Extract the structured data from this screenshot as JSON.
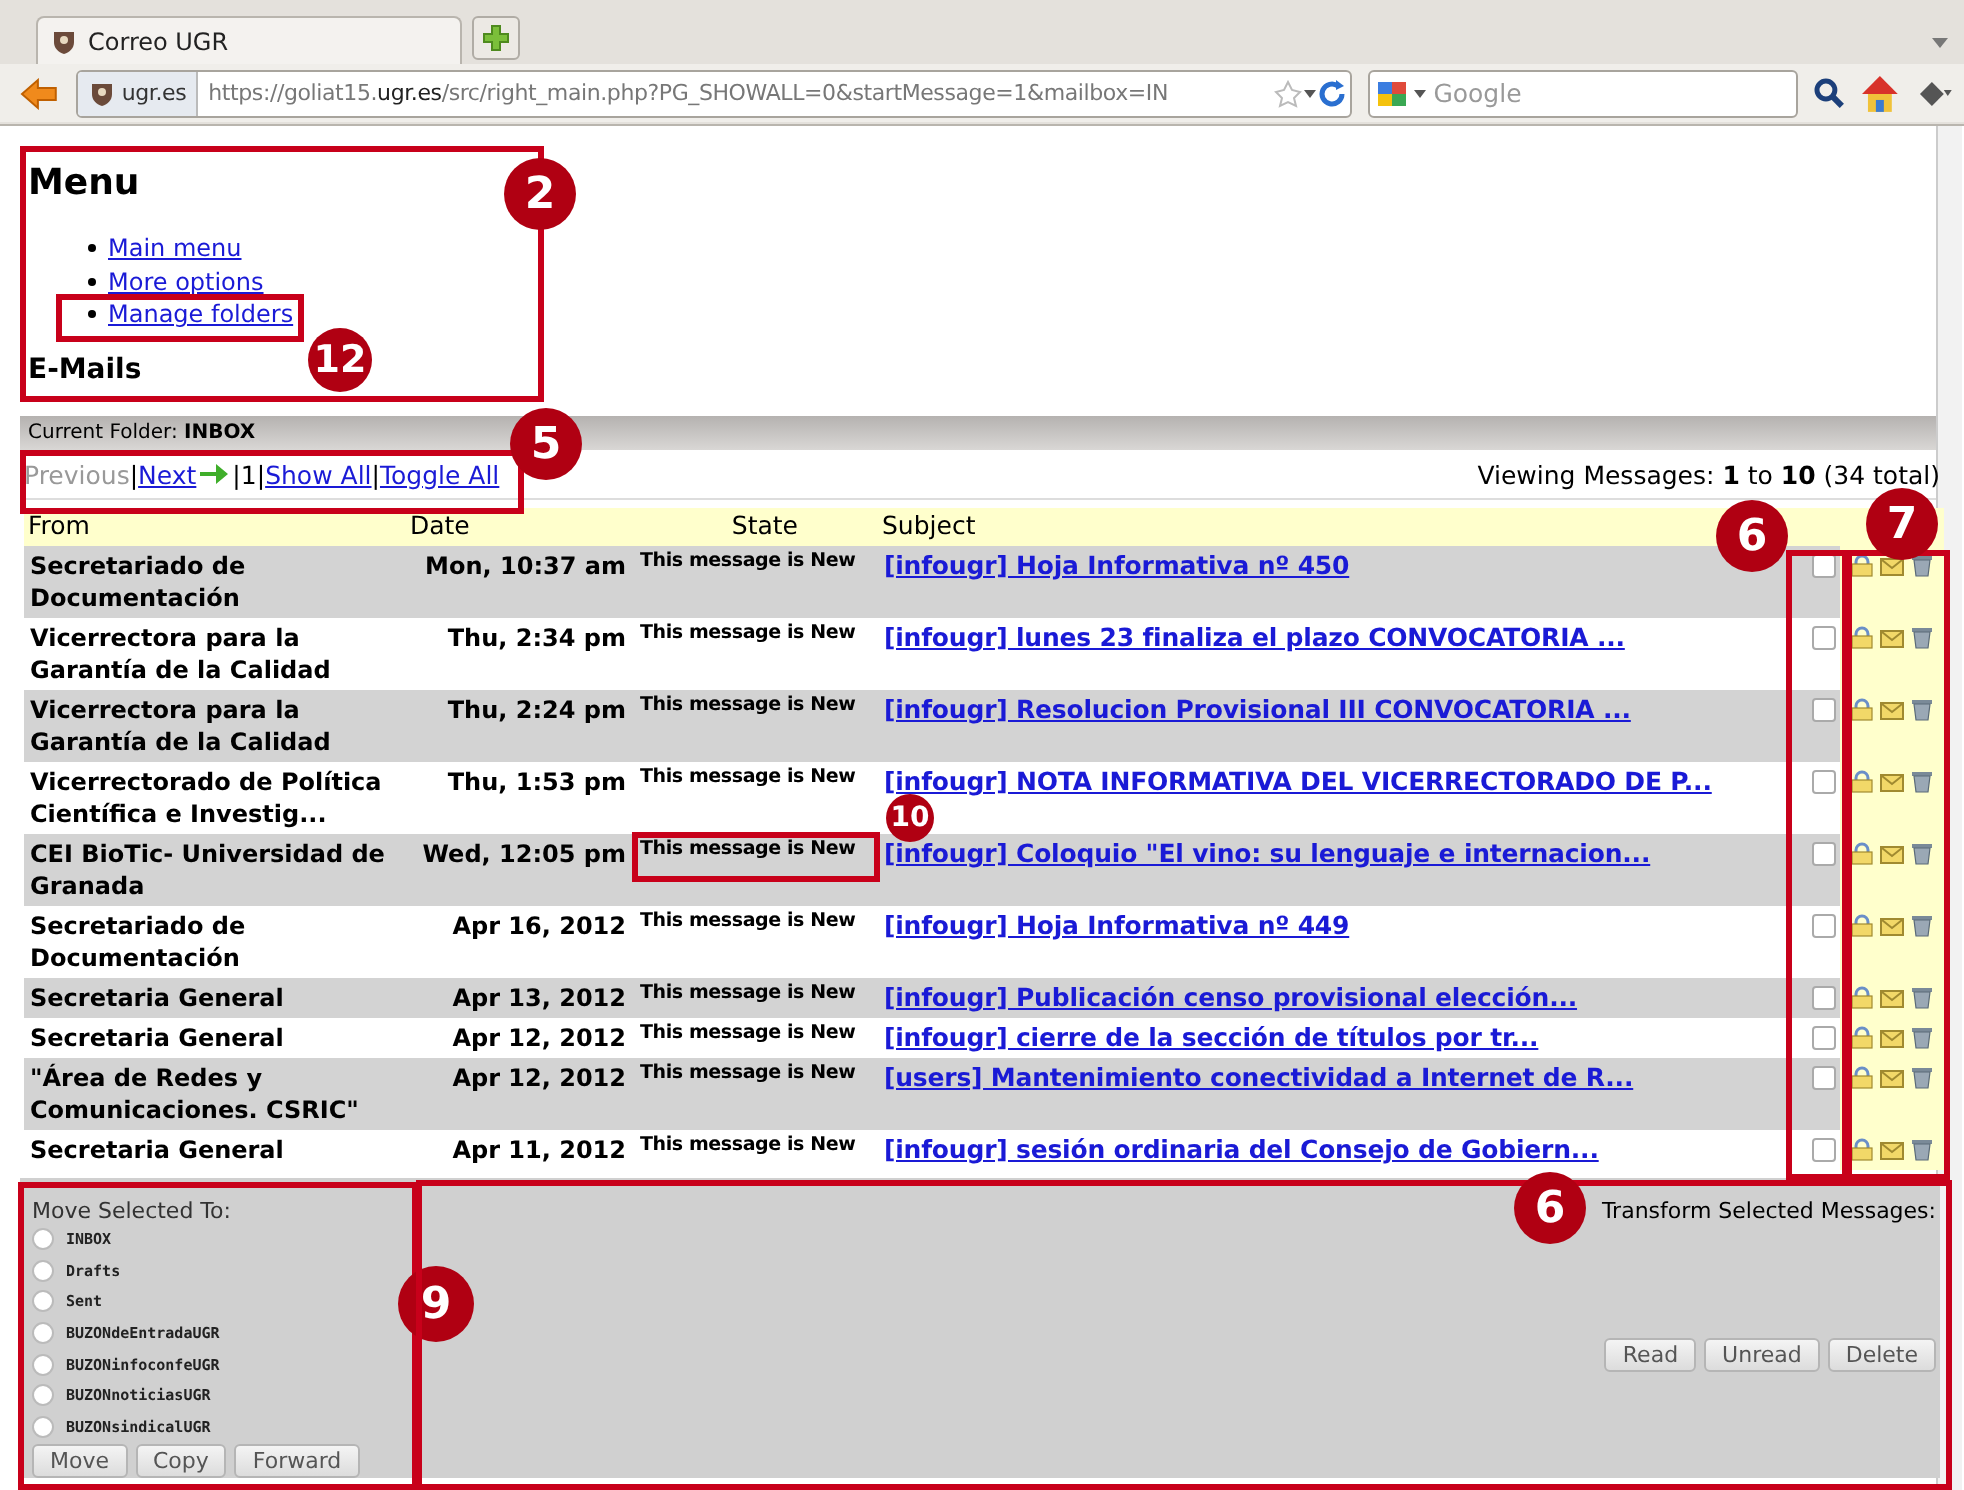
{
  "browser": {
    "tab_title": "Correo UGR",
    "site_identity": "ugr.es",
    "url": "https://goliat15.**ugr.es**/src/right_main.php?PG_SHOWALL=0&startMessage=1&mailbox=IN",
    "search": {
      "placeholder": "Google"
    }
  },
  "menu": {
    "title": "Menu",
    "links": [
      "Main menu",
      "More options",
      "Manage folders"
    ]
  },
  "section_title": "E-Mails",
  "current_folder": "Current Folder: **INBOX**",
  "pagination": [
    {
      "text": "Previous",
      "kind": "disabled"
    },
    {
      "text": "|",
      "kind": "separator"
    },
    {
      "text": "Next",
      "kind": "next"
    },
    {
      "text": "|",
      "kind": "separator"
    },
    {
      "text": "1",
      "kind": "text"
    },
    {
      "text": "|",
      "kind": "separator"
    },
    {
      "text": "Show All",
      "kind": "link"
    },
    {
      "text": "|",
      "kind": "separator"
    },
    {
      "text": "Toggle All",
      "kind": "link"
    }
  ],
  "viewing": "Viewing Messages: **1** to **10** (34 total)",
  "table": {
    "columns": [
      "From",
      "Date",
      "State",
      "Subject"
    ],
    "rows": [
      {
        "from": "Secretariado de Documentación",
        "date": "Mon, 10:37 am",
        "state": "This message is New",
        "subject": "[infougr] Hoja Informativa nº 450",
        "checked": false
      },
      {
        "from": "Vicerrectora para la Garantía de la Calidad",
        "date": "Thu, 2:34 pm",
        "state": "This message is New",
        "subject": "[infougr] lunes 23 finaliza el plazo CONVOCATORIA ...",
        "checked": false
      },
      {
        "from": "Vicerrectora para la Garantía de la Calidad",
        "date": "Thu, 2:24 pm",
        "state": "This message is New",
        "subject": "[infougr] Resolucion Provisional III CONVOCATORIA ...",
        "checked": false
      },
      {
        "from": "Vicerrectorado de Política Científica e Investig...",
        "date": "Thu, 1:53 pm",
        "state": "This message is New",
        "subject": "[infougr] NOTA INFORMATIVA DEL VICERRECTORADO DE P...",
        "checked": false
      },
      {
        "from": "CEI BioTic- Universidad de Granada",
        "date": "Wed, 12:05 pm",
        "state": "This message is New",
        "subject": "[infougr] Coloquio \"El vino: su lenguaje e internacion...",
        "checked": false
      },
      {
        "from": "Secretariado de Documentación",
        "date": "Apr 16, 2012",
        "state": "This message is New",
        "subject": "[infougr] Hoja Informativa nº 449",
        "checked": false
      },
      {
        "from": "Secretaria General",
        "date": "Apr 13, 2012",
        "state": "This message is New",
        "subject": "[infougr] Publicación censo provisional elección...",
        "checked": false
      },
      {
        "from": "Secretaria General",
        "date": "Apr 12, 2012",
        "state": "This message is New",
        "subject": "[infougr] cierre de la sección de títulos por tr...",
        "checked": false
      },
      {
        "from": "\"Área de Redes y Comunicaciones. CSRIC\"",
        "date": "Apr 12, 2012",
        "state": "This message is New",
        "subject": "[users] Mantenimiento conectividad a Internet de R...",
        "checked": false
      },
      {
        "from": "Secretaria General",
        "date": "Apr 11, 2012",
        "state": "This message is New",
        "subject": "[infougr] sesión ordinaria del Consejo de Gobiern...",
        "checked": false
      }
    ]
  },
  "move": {
    "label": "Move Selected To:",
    "folders": [
      {
        "name": "INBOX",
        "selected": false
      },
      {
        "name": "Drafts",
        "selected": false
      },
      {
        "name": "Sent",
        "selected": false
      },
      {
        "name": "BUZONdeEntradaUGR",
        "selected": false
      },
      {
        "name": "BUZONinfoconfeUGR",
        "selected": false
      },
      {
        "name": "BUZONnoticiasUGR",
        "selected": false
      },
      {
        "name": "BUZONsindicalUGR",
        "selected": false
      }
    ],
    "buttons": [
      "Move",
      "Copy",
      "Forward"
    ]
  },
  "transform": {
    "label": "Transform Selected Messages:",
    "buttons": [
      "Read",
      "Unread",
      "Delete"
    ]
  },
  "annotations": [
    {
      "label": "2"
    },
    {
      "label": "12"
    },
    {
      "label": "5"
    },
    {
      "label": "6"
    },
    {
      "label": "7"
    },
    {
      "label": "10"
    },
    {
      "label": "9"
    },
    {
      "label": "6"
    }
  ]
}
